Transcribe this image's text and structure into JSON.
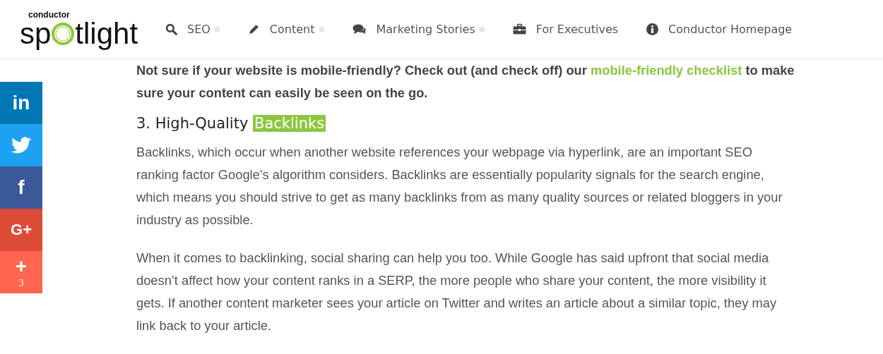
{
  "logo": {
    "brand": "conductor",
    "wordmark_start": "sp",
    "wordmark_end": "tlight"
  },
  "nav": [
    {
      "label": "SEO",
      "kind": "search",
      "has_submenu": true
    },
    {
      "label": "Content",
      "kind": "pencil",
      "has_submenu": true
    },
    {
      "label": "Marketing Stories",
      "kind": "comments",
      "has_submenu": true
    },
    {
      "label": "For Executives",
      "kind": "briefcase",
      "has_submenu": false
    },
    {
      "label": "Conductor Homepage",
      "kind": "info",
      "has_submenu": false
    }
  ],
  "share": [
    {
      "kind": "linkedin",
      "glyph": "in",
      "color": "#0077b5"
    },
    {
      "kind": "twitter",
      "color": "#1da1f2"
    },
    {
      "kind": "facebook",
      "glyph": "f",
      "color": "#3b5998"
    },
    {
      "kind": "googleplus",
      "glyph": "G+",
      "color": "#dd4b39"
    },
    {
      "kind": "more",
      "glyph": "+",
      "count": "3",
      "color": "#ff6550"
    }
  ],
  "article": {
    "callout": {
      "before": "Not sure if your website is mobile-friendly? Check out (and check off) our ",
      "link": "mobile-friendly checklist",
      "after": " to make sure your content can easily be seen on the go."
    },
    "heading": {
      "text": "3. High-Quality",
      "highlight": "Backlinks"
    },
    "paragraphs": [
      "Backlinks, which occur when another website references your webpage via hyperlink, are an important SEO ranking factor Google’s algorithm considers. Backlinks are essentially popularity signals for the search engine, which means you should strive to get as many backlinks from as many quality sources or related bloggers in your industry as possible.",
      "When it comes to backlinking, social sharing can help you too. While Google has said upfront that social media doesn’t affect how your content ranks in a SERP, the more people who share your content, the more visibility it gets. If another content marketer sees your article on Twitter and writes an article about a similar topic, they may link back to your article."
    ]
  }
}
